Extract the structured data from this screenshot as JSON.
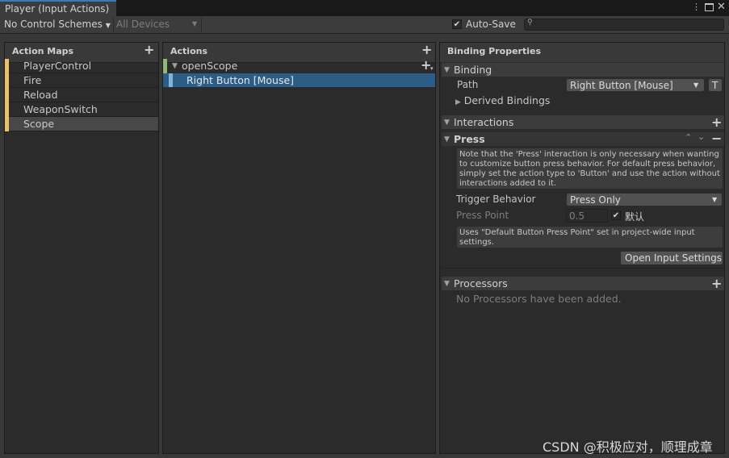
{
  "window": {
    "tab_title": "Player (Input Actions)",
    "icons": [
      "more-vertical-icon",
      "maximize-icon",
      "close-icon"
    ]
  },
  "toolbar": {
    "control_schemes": "No Control Schemes",
    "devices": "All Devices",
    "autosave_label": "Auto-Save",
    "autosave_checked": true,
    "search_value": ""
  },
  "action_maps": {
    "header": "Action Maps",
    "items": [
      {
        "label": "PlayerControl"
      },
      {
        "label": "Fire"
      },
      {
        "label": "Reload"
      },
      {
        "label": "WeaponSwitch"
      },
      {
        "label": "Scope"
      }
    ],
    "selected": "Scope"
  },
  "actions": {
    "header": "Actions",
    "action_label": "openScope",
    "binding_label": "Right Button [Mouse]"
  },
  "binding_properties": {
    "header": "Binding Properties",
    "binding_section": "Binding",
    "path_label": "Path",
    "path_value": "Right Button [Mouse]",
    "t_button": "T",
    "derived_bindings": "Derived Bindings",
    "interactions_section": "Interactions",
    "press_label": "Press",
    "press_help": "Note that the 'Press' interaction is only necessary when wanting to customize button press behavior. For default press behavior, simply set the action type to 'Button' and use the action without interactions added to it.",
    "trigger_label": "Trigger Behavior",
    "trigger_value": "Press Only",
    "press_point_label": "Press Point",
    "press_point_value": "0.5",
    "default_label": "默认",
    "default_checked": true,
    "press_point_help": "Uses \"Default Button Press Point\" set in project-wide input settings.",
    "open_settings_button": "Open Input Settings",
    "processors_section": "Processors",
    "no_processors": "No Processors have been added."
  },
  "watermark": "CSDN @积极应对，顺理成章",
  "colors": {
    "selection_blue": "#2c5d87",
    "map_marker_yellow": "#e6c36a",
    "action_marker_green": "#90b874",
    "binding_marker_blue": "#7fb5d8",
    "tab_accent": "#3a79bb"
  }
}
